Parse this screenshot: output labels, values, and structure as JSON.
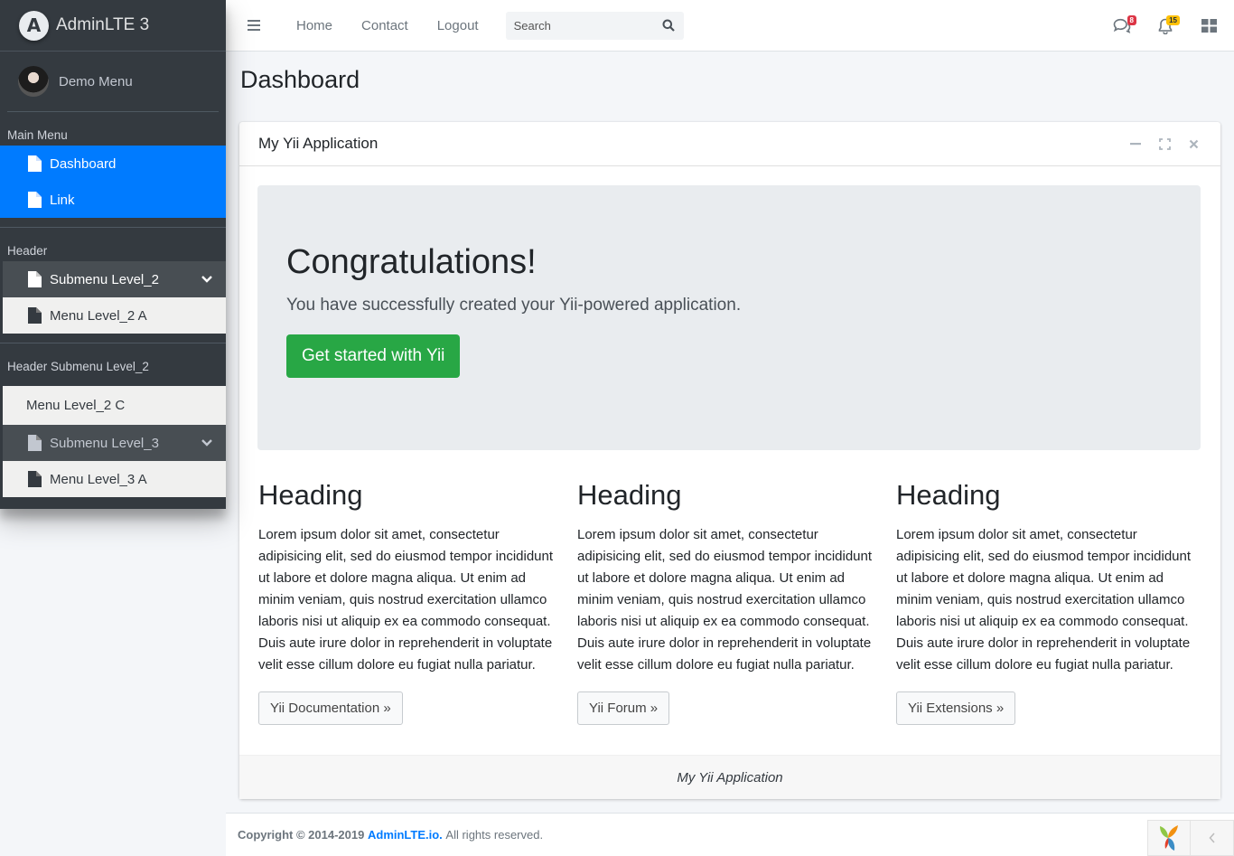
{
  "brand": {
    "logo_letter": "A",
    "text": "AdminLTE 3"
  },
  "user": {
    "name": "Demo Menu"
  },
  "sidebar": {
    "main_header": "Main Menu",
    "main_items": [
      {
        "label": "Dashboard",
        "icon": "file-icon"
      },
      {
        "label": "Link",
        "icon": "file-icon"
      }
    ],
    "header_label": "Header",
    "submenu_level2": {
      "label": "Submenu Level_2",
      "icon": "file-icon",
      "chevron": "chevron-down-icon"
    },
    "menu_level2a": "Menu Level_2 A",
    "header_submenu": "Header Submenu Level_2",
    "menu_level2c": "Menu Level_2 C",
    "submenu_level3": {
      "label": "Submenu Level_3",
      "icon": "file-icon",
      "chevron": "chevron-down-icon"
    },
    "menu_level3a": "Menu Level_3 A"
  },
  "navbar": {
    "links": [
      "Home",
      "Contact",
      "Logout"
    ],
    "search_placeholder": "Search",
    "messages_badge": "8",
    "notifications_badge": "15",
    "colors": {
      "badge_red": "#dc3545",
      "badge_yellow": "#ffc107"
    }
  },
  "page": {
    "title": "Dashboard"
  },
  "card": {
    "title": "My Yii Application",
    "jumbotron": {
      "heading": "Congratulations!",
      "lead": "You have successfully created your Yii-powered application.",
      "button": "Get started with Yii"
    },
    "columns": [
      {
        "heading": "Heading",
        "body": "Lorem ipsum dolor sit amet, consectetur adipisicing elit, sed do eiusmod tempor incididunt ut labore et dolore magna aliqua. Ut enim ad minim veniam, quis nostrud exercitation ullamco laboris nisi ut aliquip ex ea commodo consequat. Duis aute irure dolor in reprehenderit in voluptate velit esse cillum dolore eu fugiat nulla pariatur.",
        "button": "Yii Documentation »"
      },
      {
        "heading": "Heading",
        "body": "Lorem ipsum dolor sit amet, consectetur adipisicing elit, sed do eiusmod tempor incididunt ut labore et dolore magna aliqua. Ut enim ad minim veniam, quis nostrud exercitation ullamco laboris nisi ut aliquip ex ea commodo consequat. Duis aute irure dolor in reprehenderit in voluptate velit esse cillum dolore eu fugiat nulla pariatur.",
        "button": "Yii Forum »"
      },
      {
        "heading": "Heading",
        "body": "Lorem ipsum dolor sit amet, consectetur adipisicing elit, sed do eiusmod tempor incididunt ut labore et dolore magna aliqua. Ut enim ad minim veniam, quis nostrud exercitation ullamco laboris nisi ut aliquip ex ea commodo consequat. Duis aute irure dolor in reprehenderit in voluptate velit esse cillum dolore eu fugiat nulla pariatur.",
        "button": "Yii Extensions »"
      }
    ],
    "footer": "My Yii Application"
  },
  "footer": {
    "copyright_prefix": "Copyright © 2014-2019",
    "link": "AdminLTE.io.",
    "suffix": "All rights reserved."
  },
  "colors": {
    "primary": "#007bff",
    "success": "#28a745",
    "sidebar_bg": "#343a40"
  }
}
